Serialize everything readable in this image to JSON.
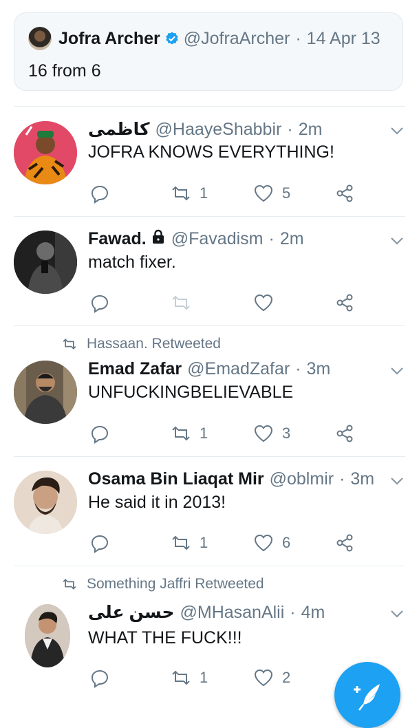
{
  "quoted": {
    "name": "Jofra Archer",
    "handle": "@JofraArcher",
    "sep": "·",
    "date": "14 Apr 13",
    "text": "16 from 6"
  },
  "tweets": [
    {
      "name": "كاظمی",
      "handle": "@HaayeShabbir",
      "time": "2m",
      "text": "JOFRA KNOWS EVERYTHING!",
      "retweets": "1",
      "likes": "5"
    },
    {
      "name": "Fawad.",
      "handle": "@Favadism",
      "time": "2m",
      "text": "match fixer.",
      "retweets": "",
      "likes": ""
    },
    {
      "retweeted_by": "Hassaan. Retweeted",
      "name": "Emad Zafar",
      "handle": "@EmadZafar",
      "time": "3m",
      "text": "UNFUCKINGBELIEVABLE",
      "retweets": "1",
      "likes": "3"
    },
    {
      "name": "Osama Bin Liaqat Mir",
      "handle": "@oblmir",
      "time": "3m",
      "text": "He said it in 2013!",
      "retweets": "1",
      "likes": "6"
    },
    {
      "retweeted_by": "Something Jaffri Retweeted",
      "name": "حسن علی",
      "handle": "@MHasanAlii",
      "time": "4m",
      "text": "WHAT THE FUCK!!!",
      "retweets": "1",
      "likes": "2"
    }
  ],
  "sep": "·",
  "colors": {
    "accent": "#1da1f2",
    "muted": "#657786",
    "text": "#14171a"
  },
  "icons": [
    "verified-icon",
    "reply-icon",
    "retweet-icon",
    "like-icon",
    "share-icon",
    "chevron-down-icon",
    "lock-icon",
    "compose-icon"
  ]
}
